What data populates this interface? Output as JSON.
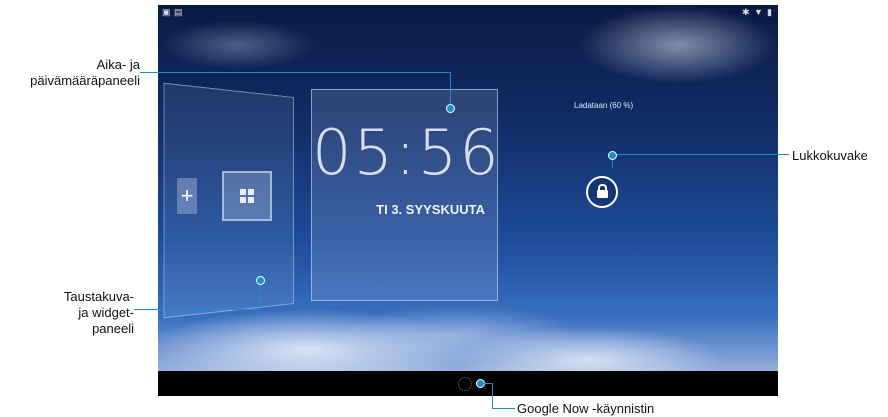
{
  "callouts": {
    "clock_panel_line1": "Aika- ja",
    "clock_panel_line2": "päivämääräpaneeli",
    "widget_panel_line1": "Taustakuva-",
    "widget_panel_line2": "ja widget-",
    "widget_panel_line3": "paneeli",
    "lock_icon": "Lukkokuvake",
    "google_now": "Google Now -käynnistin"
  },
  "screen": {
    "clock_time": "05:56",
    "clock_date": "TI 3. SYYSKUUTA",
    "charging_text": "Ladataan (60 %)",
    "add_symbol": "+"
  },
  "icons": {
    "status_left": [
      "notification-icon",
      "screenshot-icon"
    ],
    "status_right": [
      "bluetooth-icon",
      "wifi-icon",
      "battery-icon"
    ],
    "lock": "lock-icon",
    "google_now": "google-now-icon",
    "widgets": "widgets-icon"
  },
  "colors": {
    "callout_line": "#1a8fd0",
    "nav_bar": "#000000"
  }
}
